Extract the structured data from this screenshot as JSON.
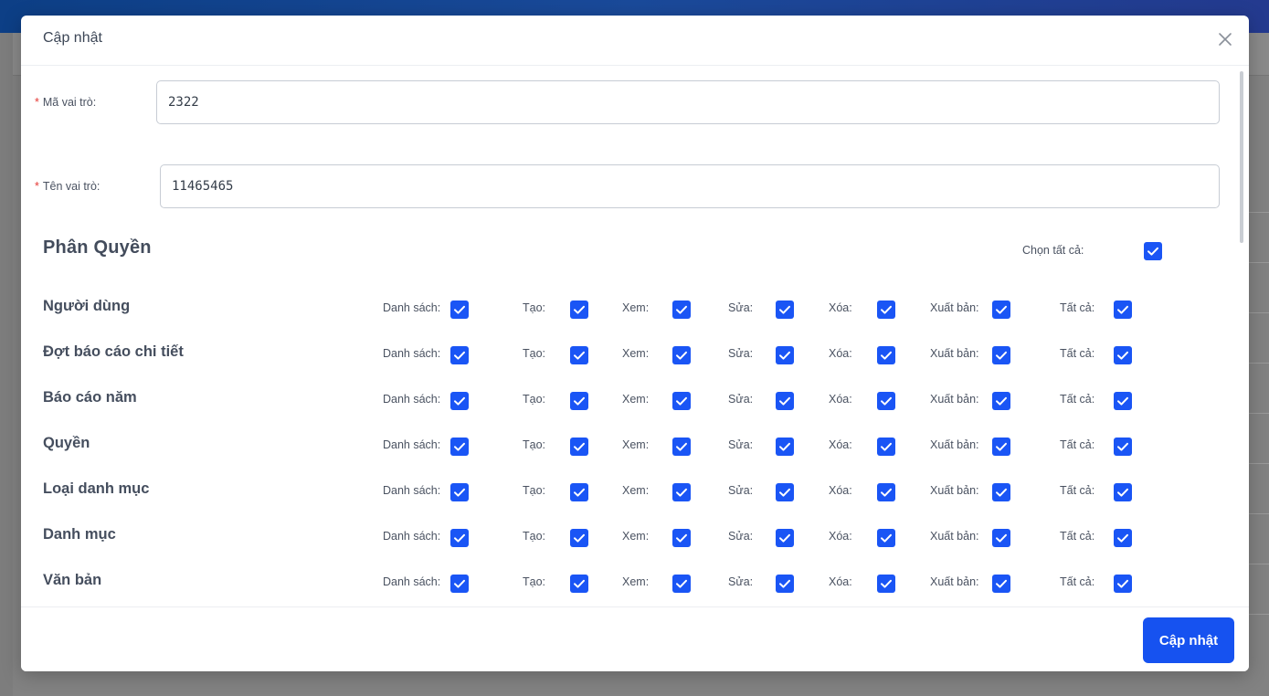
{
  "modal": {
    "title": "Cập nhật",
    "submit_label": "Cập nhật"
  },
  "form": {
    "role_code": {
      "label": "Mã vai trò:",
      "value": "2322",
      "required_mark": "*"
    },
    "role_name": {
      "label": "Tên vai trò:",
      "value": "11465465",
      "required_mark": "*"
    }
  },
  "permissions": {
    "title": "Phân Quyền",
    "select_all_label": "Chọn tất cả:",
    "select_all_checked": true,
    "columns": [
      "Danh sách:",
      "Tạo:",
      "Xem:",
      "Sửa:",
      "Xóa:",
      "Xuất bản:",
      "Tất cả:"
    ],
    "rows": [
      {
        "name": "Người dùng",
        "checked": [
          true,
          true,
          true,
          true,
          true,
          true,
          true
        ]
      },
      {
        "name": "Đợt báo cáo chi tiết",
        "checked": [
          true,
          true,
          true,
          true,
          true,
          true,
          true
        ]
      },
      {
        "name": "Báo cáo năm",
        "checked": [
          true,
          true,
          true,
          true,
          true,
          true,
          true
        ]
      },
      {
        "name": "Quyền",
        "checked": [
          true,
          true,
          true,
          true,
          true,
          true,
          true
        ]
      },
      {
        "name": "Loại danh mục",
        "checked": [
          true,
          true,
          true,
          true,
          true,
          true,
          true
        ]
      },
      {
        "name": "Danh mục",
        "checked": [
          true,
          true,
          true,
          true,
          true,
          true,
          true
        ]
      },
      {
        "name": "Văn bản",
        "checked": [
          true,
          true,
          true,
          true,
          true,
          true,
          true
        ]
      }
    ]
  },
  "colors": {
    "primary": "#1652f0",
    "checkbox": "#1a55f5",
    "required": "#e53935",
    "header_gradient_start": "#0d3f86",
    "header_gradient_end": "#243a8f"
  }
}
